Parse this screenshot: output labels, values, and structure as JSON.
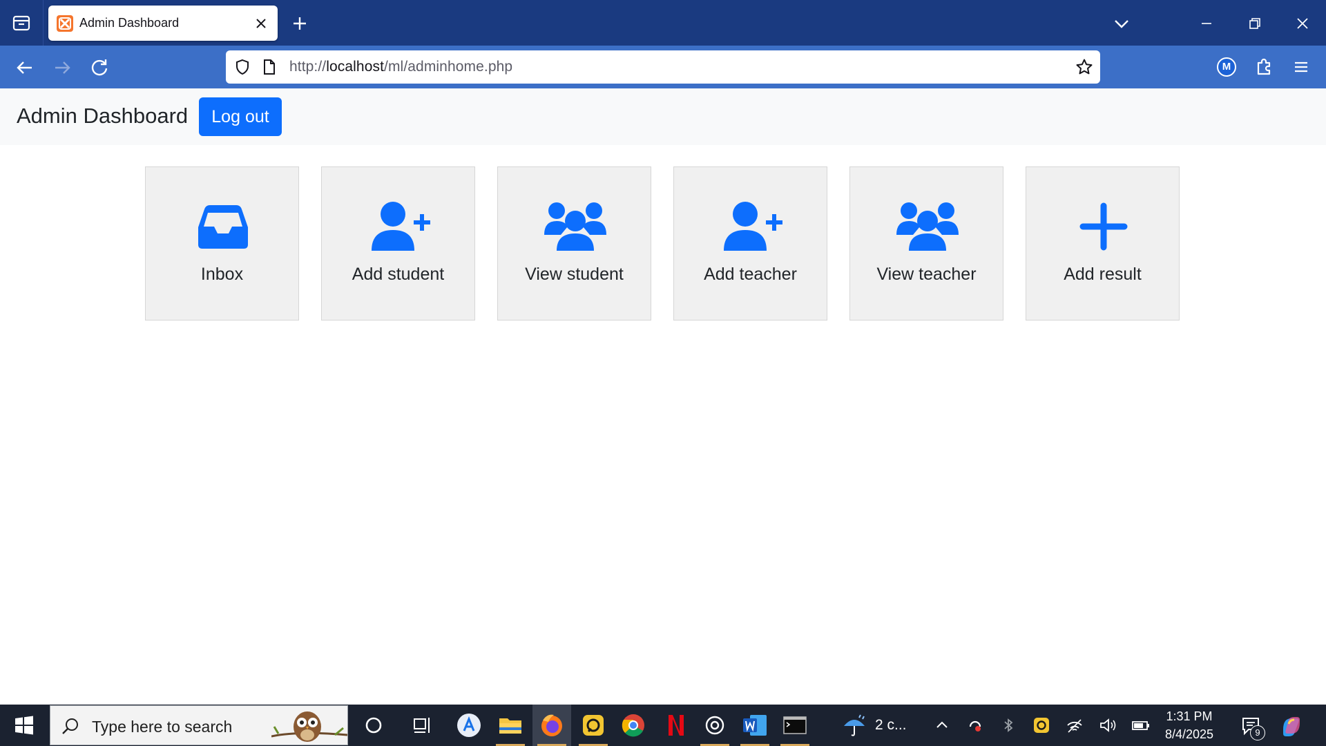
{
  "browser": {
    "tab": {
      "title": "Admin Dashboard"
    },
    "url": {
      "prefix": "http://",
      "host": "localhost",
      "path": "/ml/adminhome.php"
    },
    "account_initial": "M"
  },
  "page": {
    "brand": "Admin Dashboard",
    "logout_label": "Log out",
    "accent_color": "#0d6efd",
    "cards": [
      {
        "label": "Inbox",
        "icon": "inbox-icon"
      },
      {
        "label": "Add student",
        "icon": "user-plus-icon"
      },
      {
        "label": "View student",
        "icon": "users-icon"
      },
      {
        "label": "Add teacher",
        "icon": "user-plus-icon"
      },
      {
        "label": "View teacher",
        "icon": "users-icon"
      },
      {
        "label": "Add result",
        "icon": "plus-icon"
      }
    ]
  },
  "taskbar": {
    "search_placeholder": "Type here to search",
    "weather_text": "2 c...",
    "time": "1:31 PM",
    "date": "8/4/2025",
    "notification_count": "9"
  }
}
